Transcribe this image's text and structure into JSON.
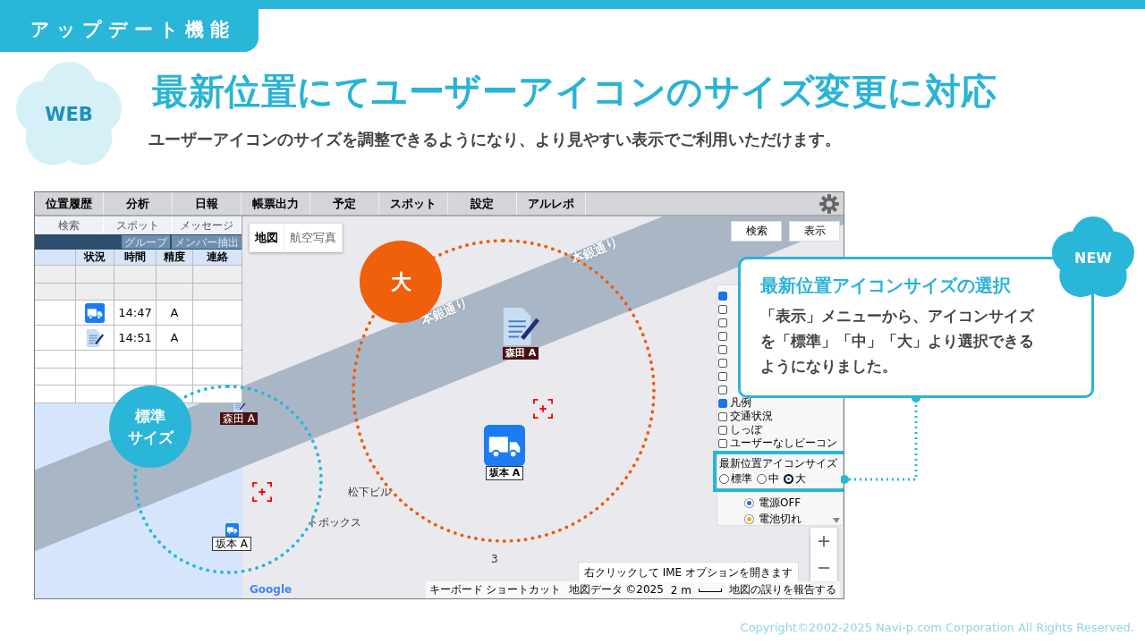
{
  "header_tag": "アップデート機能",
  "platform_badge": "WEB",
  "title": "最新位置にてユーザーアイコンのサイズ変更に対応",
  "subtitle": "ユーザーアイコンのサイズを調整できるようになり、より見やすい表示でご利用いただけます。",
  "app": {
    "menu": [
      "位置履歴",
      "分析",
      "日報",
      "帳票出力",
      "予定",
      "スポット",
      "設定",
      "アルレポ"
    ],
    "side_tabs": [
      "検索",
      "スポット",
      "メッセージ"
    ],
    "side_buttons": [
      "グループ",
      "メンバー抽出"
    ],
    "table": {
      "columns": [
        "状況",
        "時間",
        "精度",
        "連絡"
      ],
      "rows": [
        {
          "kind": "empty"
        },
        {
          "kind": "empty"
        },
        {
          "kind": "truck",
          "time": "14:47",
          "accuracy": "A"
        },
        {
          "kind": "memo",
          "time": "14:51",
          "accuracy": "A"
        },
        {
          "kind": "empty"
        },
        {
          "kind": "empty"
        },
        {
          "kind": "empty"
        }
      ]
    },
    "map": {
      "view_tabs": [
        {
          "label": "地図",
          "selected": true
        },
        {
          "label": "航空写真",
          "selected": false
        }
      ],
      "road_labels": [
        "本銀通り",
        "本銀通り"
      ],
      "place_labels": [
        "松下ビル",
        "トボックス",
        "3"
      ],
      "markers": [
        {
          "kind": "memo",
          "large": true,
          "label": "森田 A"
        },
        {
          "kind": "truck",
          "large": true,
          "label": "坂本 A"
        },
        {
          "kind": "memo",
          "large": false,
          "label": "森田 A"
        },
        {
          "kind": "truck",
          "large": false,
          "label": "坂本 A"
        }
      ],
      "buttons": [
        "検索",
        "表示"
      ],
      "legend": {
        "checkboxes": [
          {
            "checked": true
          },
          {
            "checked": false
          },
          {
            "checked": false
          },
          {
            "checked": false
          },
          {
            "checked": false
          },
          {
            "checked": false
          },
          {
            "checked": false
          },
          {
            "checked": false
          },
          {
            "label": "凡例",
            "checked": true
          },
          {
            "label": "交通状況",
            "checked": false
          },
          {
            "label": "しっぽ",
            "checked": false
          },
          {
            "label": "ユーザーなしビーコン",
            "checked": false
          }
        ],
        "icon_size": {
          "title": "最新位置アイコンサイズ",
          "options": [
            {
              "label": "標準",
              "selected": false
            },
            {
              "label": "中",
              "selected": false
            },
            {
              "label": "大",
              "selected": true
            }
          ]
        },
        "statuses": [
          {
            "label": "電源OFF",
            "color": "#3f5fd0"
          },
          {
            "label": "電池切れ",
            "color": "#e8b400"
          }
        ]
      },
      "tooltip": "右クリックして IME オプションを開きます",
      "logo": "Google",
      "attribution": [
        "キーボード ショートカット",
        "地図データ ©2025",
        "2 m",
        "地図の誤りを報告する"
      ]
    }
  },
  "size_markers": [
    {
      "kind": "large",
      "lines": [
        "大"
      ]
    },
    {
      "kind": "standard",
      "lines": [
        "標準",
        "サイズ"
      ]
    }
  ],
  "callout": {
    "badge": "NEW",
    "title": "最新位置アイコンサイズの選択",
    "body": "「表示」メニューから、アイコンサイズを「標準」「中」「大」より選択できるようになりました。"
  },
  "copyright": "Copyright©2002-2025 Navi-p.com Corporation All Rights Reserved."
}
